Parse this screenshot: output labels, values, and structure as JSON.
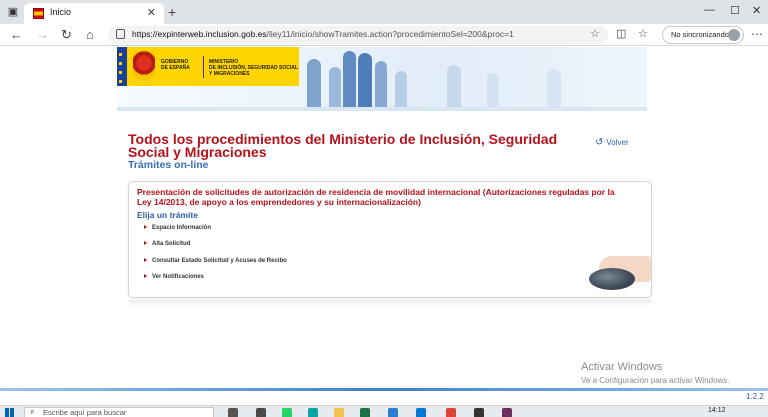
{
  "browser": {
    "tab_title": "Inicio",
    "url_host": "https://expinterweb.inclusion.gob.es",
    "url_path": "/iley11/inicio/showTramites.action?procedimientoSel=200&proc=1",
    "profile_label": "No sincronizando"
  },
  "header": {
    "gov_line1": "GOBIERNO",
    "gov_line2": "DE ESPAÑA",
    "ministry_line1": "MINISTERIO",
    "ministry_line2": "DE INCLUSIÓN, SEGURIDAD SOCIAL",
    "ministry_line3": "Y MIGRACIONES"
  },
  "page": {
    "title": "Todos los procedimientos del Ministerio de Inclusión, Seguridad Social y Migraciones",
    "volver": "Volver",
    "subtitle": "Trámites on-line"
  },
  "procedure": {
    "title": "Presentación de solicitudes de autorización de residencia de movilidad internacional (Autorizaciones reguladas por la Ley 14/2013, de apoyo a los emprendedores y su internacionalización)",
    "prompt": "Elija un trámite",
    "options": [
      "Espacio Información",
      "Alta Solicitud",
      "Consultar Estado Solicitud y Acuses de Recibo",
      "Ver Notificaciones"
    ]
  },
  "watermark": {
    "line1": "Activar Windows",
    "line2": "Ve a Configuración para activar Windows."
  },
  "version": "1.2.2",
  "taskbar": {
    "search_placeholder": "Escribe aquí para buscar",
    "time": "14:12"
  },
  "colors": {
    "title_red": "#b5121b",
    "link_blue": "#2e5fa8"
  }
}
